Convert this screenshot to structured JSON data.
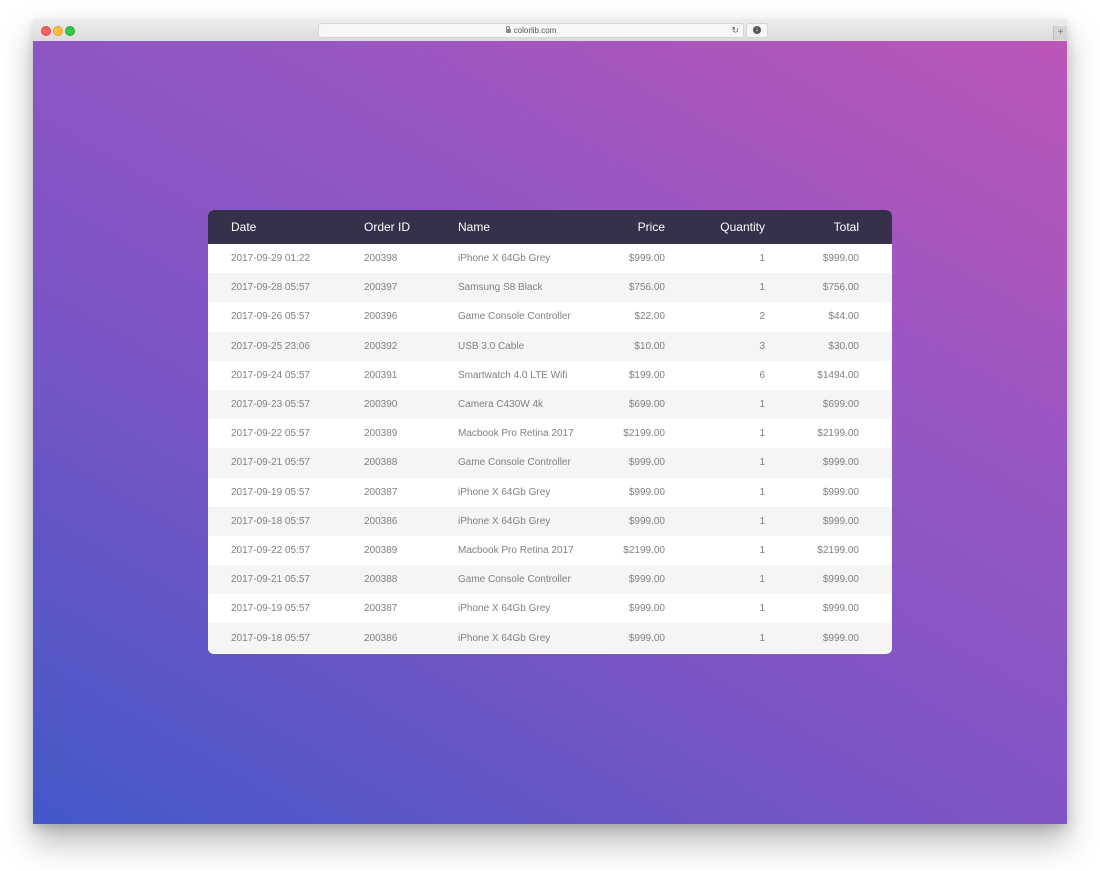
{
  "browser": {
    "url": "colorlib.com",
    "new_tab_label": "+"
  },
  "table": {
    "headers": {
      "date": "Date",
      "order_id": "Order ID",
      "name": "Name",
      "price": "Price",
      "quantity": "Quantity",
      "total": "Total"
    },
    "rows": [
      {
        "date": "2017-09-29 01:22",
        "order_id": "200398",
        "name": "iPhone X 64Gb Grey",
        "price": "$999.00",
        "quantity": "1",
        "total": "$999.00"
      },
      {
        "date": "2017-09-28 05:57",
        "order_id": "200397",
        "name": "Samsung S8 Black",
        "price": "$756.00",
        "quantity": "1",
        "total": "$756.00"
      },
      {
        "date": "2017-09-26 05:57",
        "order_id": "200396",
        "name": "Game Console Controller",
        "price": "$22.00",
        "quantity": "2",
        "total": "$44.00"
      },
      {
        "date": "2017-09-25 23:06",
        "order_id": "200392",
        "name": "USB 3.0 Cable",
        "price": "$10.00",
        "quantity": "3",
        "total": "$30.00"
      },
      {
        "date": "2017-09-24 05:57",
        "order_id": "200391",
        "name": "Smartwatch 4.0 LTE Wifi",
        "price": "$199.00",
        "quantity": "6",
        "total": "$1494.00"
      },
      {
        "date": "2017-09-23 05:57",
        "order_id": "200390",
        "name": "Camera C430W 4k",
        "price": "$699.00",
        "quantity": "1",
        "total": "$699.00"
      },
      {
        "date": "2017-09-22 05:57",
        "order_id": "200389",
        "name": "Macbook Pro Retina 2017",
        "price": "$2199.00",
        "quantity": "1",
        "total": "$2199.00"
      },
      {
        "date": "2017-09-21 05:57",
        "order_id": "200388",
        "name": "Game Console Controller",
        "price": "$999.00",
        "quantity": "1",
        "total": "$999.00"
      },
      {
        "date": "2017-09-19 05:57",
        "order_id": "200387",
        "name": "iPhone X 64Gb Grey",
        "price": "$999.00",
        "quantity": "1",
        "total": "$999.00"
      },
      {
        "date": "2017-09-18 05:57",
        "order_id": "200386",
        "name": "iPhone X 64Gb Grey",
        "price": "$999.00",
        "quantity": "1",
        "total": "$999.00"
      },
      {
        "date": "2017-09-22 05:57",
        "order_id": "200389",
        "name": "Macbook Pro Retina 2017",
        "price": "$2199.00",
        "quantity": "1",
        "total": "$2199.00"
      },
      {
        "date": "2017-09-21 05:57",
        "order_id": "200388",
        "name": "Game Console Controller",
        "price": "$999.00",
        "quantity": "1",
        "total": "$999.00"
      },
      {
        "date": "2017-09-19 05:57",
        "order_id": "200387",
        "name": "iPhone X 64Gb Grey",
        "price": "$999.00",
        "quantity": "1",
        "total": "$999.00"
      },
      {
        "date": "2017-09-18 05:57",
        "order_id": "200386",
        "name": "iPhone X 64Gb Grey",
        "price": "$999.00",
        "quantity": "1",
        "total": "$999.00"
      }
    ]
  },
  "colors": {
    "header_bg": "#36304a",
    "gradient_start": "#4358c9",
    "gradient_end": "#bc56b8",
    "row_alt": "#f5f5f5",
    "cell_text": "#808080"
  }
}
